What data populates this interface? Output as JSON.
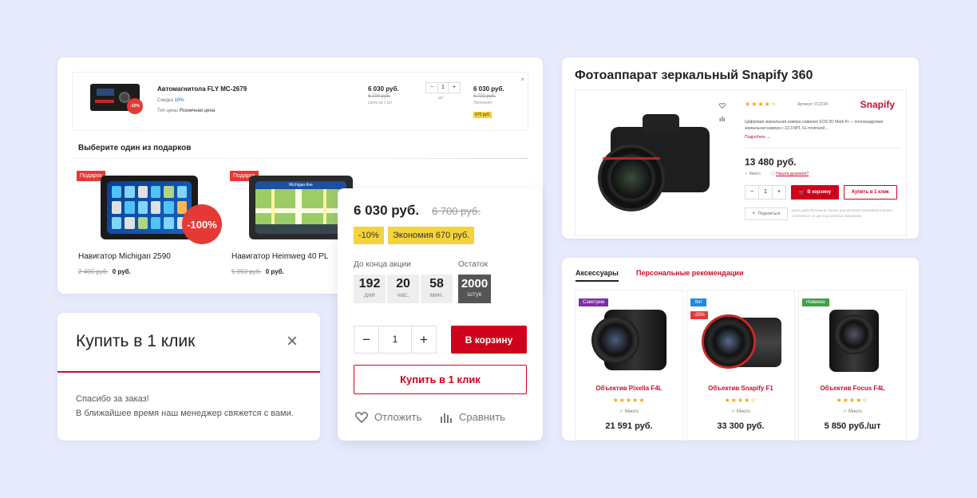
{
  "cart": {
    "product_name": "Автомагнитола FLY MC-2679",
    "discount_label": "Скидка",
    "discount_value": "10%",
    "price_type_label": "Тип цены",
    "price_type_value": "Розничная цена",
    "unit_price": "6 030 руб.",
    "unit_old_price": "6 700 руб.",
    "unit_note": "Цена за 1 шт",
    "qty": "1",
    "qty_unit": "шт",
    "total_price": "6 030 руб.",
    "total_old_price": "6 700 руб.",
    "saving_label": "Экономия",
    "saving_value": "670 руб.",
    "image_badge": "-10%",
    "close": "×",
    "gifts_title": "Выберите один из подарков",
    "gifts": [
      {
        "badge": "Подарок",
        "discount": "-100%",
        "name": "Навигатор Michigan 2590",
        "old_price": "2 400 руб.",
        "price": "0 руб."
      },
      {
        "badge": "Подарок",
        "name": "Навигатор Heimweg 40 PL",
        "old_price": "5 950 руб.",
        "price": "0 руб.",
        "map_label": "Michigan Ave"
      }
    ]
  },
  "one_click": {
    "title": "Купить в 1 клик",
    "close": "×",
    "line1": "Спасибо за заказ!",
    "line2": "В ближайшее время наш менеджер свяжется с вами."
  },
  "buy_box": {
    "price": "6 030 руб.",
    "old_price": "6 700 руб.",
    "discount": "-10%",
    "saving": "Экономия 670 руб.",
    "countdown_label": "До конца акции",
    "stock_label": "Остаток",
    "timer": [
      {
        "value": "192",
        "unit": "дня"
      },
      {
        "value": "20",
        "unit": "час."
      },
      {
        "value": "58",
        "unit": "мин."
      }
    ],
    "stock_value": "2000",
    "stock_unit": "штук",
    "minus": "−",
    "qty": "1",
    "plus": "+",
    "cart_button": "В корзину",
    "one_click_button": "Купить в 1 клик",
    "defer": "Отложить",
    "compare": "Сравнить"
  },
  "product": {
    "title": "Фотоаппарат зеркальный Snapify 360",
    "stars": "★★★★☆",
    "article": "Артикул: 012234",
    "brand": "Snapify",
    "description": "Цифровая зеркальная камера новинка! EOS 5D Mark III — полнокадровая зеркальная камера с 22,3 МП, 61-точечной…",
    "more": "Подробнее ⌄",
    "price": "13 480 руб.",
    "stock": "Много",
    "cheaper": "Нашли дешевле?",
    "minus": "−",
    "qty": "1",
    "plus": "+",
    "cart_button": "В корзину",
    "one_click_button": "Купить в 1 клик",
    "share": "Поделиться",
    "disclaimer": "Цена действительна только для интернет-магазина и может отличаться от цен в розничных магазинах"
  },
  "recs": {
    "tabs": [
      "Аксессуары",
      "Персональные рекомендации"
    ],
    "items": [
      {
        "badge": "Советуем",
        "badge_color": "#7b2fa8",
        "name": "Объектив Pixella F4L",
        "stars": "★★★★★",
        "stock": "Много",
        "price": "21 591 руб."
      },
      {
        "badge": "Хит",
        "badge_color": "#1e88e5",
        "badge2": "-25%",
        "name": "Объектив Snapify F1",
        "stars": "★★★★☆",
        "stock": "Много",
        "price": "33 300 руб."
      },
      {
        "badge": "Новинка",
        "badge_color": "#43a047",
        "name": "Объектив Focus F4L",
        "stars": "★★★★☆",
        "stock": "Много",
        "price": "5 850 руб./шт"
      }
    ]
  }
}
